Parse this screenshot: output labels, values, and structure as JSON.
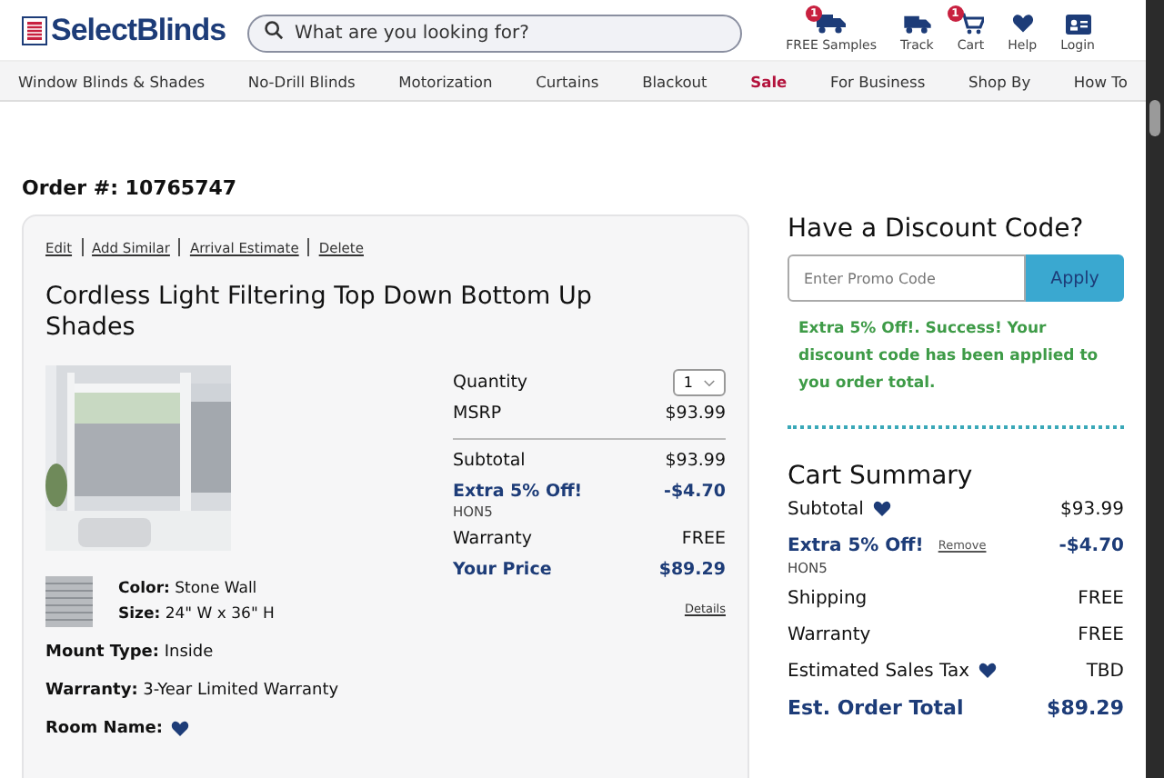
{
  "header": {
    "logo": "SelectBlinds",
    "search": {
      "placeholder": "What are you looking for?"
    },
    "actions": [
      {
        "label": "FREE Samples",
        "badge": "1"
      },
      {
        "label": "Track"
      },
      {
        "label": "Cart",
        "badge": "1"
      },
      {
        "label": "Help"
      },
      {
        "label": "Login"
      }
    ]
  },
  "nav": [
    {
      "label": "Window Blinds & Shades",
      "kind": "link"
    },
    {
      "label": "No-Drill Blinds",
      "kind": "link"
    },
    {
      "label": "Motorization",
      "kind": "link"
    },
    {
      "label": "Curtains",
      "kind": "link"
    },
    {
      "label": "Blackout",
      "kind": "link"
    },
    {
      "label": "Sale",
      "kind": "promo"
    },
    {
      "label": "For Business",
      "kind": "link"
    },
    {
      "label": "Shop By",
      "kind": "link"
    },
    {
      "label": "How To",
      "kind": "link"
    }
  ],
  "order": {
    "label": "Order #:",
    "number": "10765747"
  },
  "item": {
    "links": [
      "Edit",
      "Add Similar",
      "Arrival Estimate",
      "Delete"
    ],
    "title": "Cordless Light Filtering Top Down Bottom Up Shades",
    "image": {
      "kind": "picture"
    },
    "swatch_specs": [
      {
        "label": "Color:",
        "value": "Stone Wall"
      },
      {
        "label": "Size:",
        "value": "24\" W x 36\" H"
      }
    ],
    "specs": [
      {
        "label": "Mount Type:",
        "value": "Inside"
      },
      {
        "label": "Warranty:",
        "value": "3-Year Limited Warranty"
      },
      {
        "label": "Room Name:"
      }
    ],
    "quantity": {
      "label": "Quantity",
      "value": "1"
    },
    "pricing": [
      {
        "kind": "plain",
        "label": "MSRP",
        "value": "$93.99"
      },
      {
        "kind": "divider",
        "label": "Subtotal",
        "value": "$93.99"
      },
      {
        "kind": "discount",
        "label": "Extra 5% Off!",
        "value": "-$4.70",
        "code": "HON5"
      },
      {
        "kind": "plain",
        "label": "Warranty",
        "value": "FREE"
      },
      {
        "kind": "total",
        "label": "Your Price",
        "value": "$89.29",
        "link": "Details"
      }
    ]
  },
  "discount": {
    "title": "Have a Discount Code?",
    "placeholder": "Enter Promo Code",
    "button": "Apply",
    "message": "Extra 5% Off!. Success! Your discount code has been applied to you order total."
  },
  "summary": {
    "title": "Cart Summary",
    "rows": [
      {
        "kind": "info",
        "label": "Subtotal",
        "value": "$93.99"
      },
      {
        "kind": "discount",
        "label": "Extra 5% Off!",
        "value": "-$4.70",
        "code": "HON5",
        "link": "Remove"
      },
      {
        "kind": "plain",
        "label": "Shipping",
        "value": "FREE"
      },
      {
        "kind": "plain",
        "label": "Warranty",
        "value": "FREE"
      },
      {
        "kind": "info",
        "label": "Estimated Sales Tax",
        "value": "TBD"
      },
      {
        "kind": "total",
        "label": "Est. Order Total",
        "value": "$89.29"
      }
    ]
  }
}
